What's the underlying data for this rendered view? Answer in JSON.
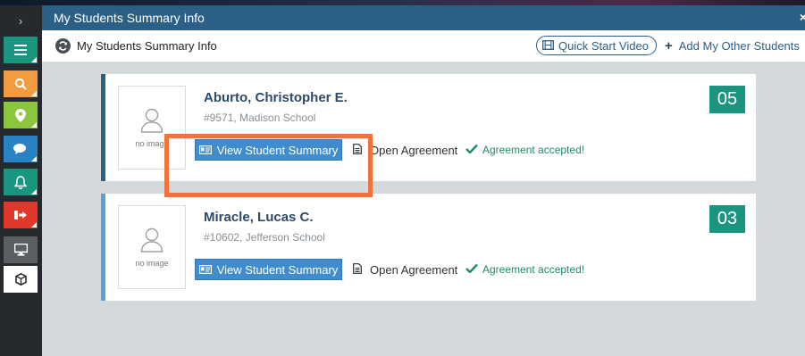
{
  "window": {
    "title": "My Students Summary Info",
    "close_label": "×"
  },
  "toolbar": {
    "title": "My Students Summary Info",
    "quick_start_label": "Quick Start Video",
    "add_students_label": "Add My Other Students"
  },
  "rail": {
    "items": [
      {
        "icon": "chevron-right-icon",
        "color": "#262a2e"
      },
      {
        "icon": "menu-icon",
        "color": "#1a9680"
      },
      {
        "icon": "search-icon",
        "color": "#f39c3f"
      },
      {
        "icon": "map-pin-icon",
        "color": "#8cc63f"
      },
      {
        "icon": "chat-icon",
        "color": "#2a82c4"
      },
      {
        "icon": "bell-icon",
        "color": "#1a9680"
      },
      {
        "icon": "sign-out-icon",
        "color": "#e0392b"
      },
      {
        "icon": "monitor-icon",
        "color": "#5a5f64"
      },
      {
        "icon": "cube-icon",
        "color": "#ffffff"
      }
    ]
  },
  "students": [
    {
      "name": "Aburto, Christopher E.",
      "details": "#9571, Madison School",
      "photo_label": "no image",
      "summary_button": "View Student Summary",
      "agreement_link": "Open Agreement",
      "agreement_status": "Agreement accepted!",
      "grade": "05"
    },
    {
      "name": "Miracle, Lucas C.",
      "details": "#10602, Jefferson School",
      "photo_label": "no image",
      "summary_button": "View Student Summary",
      "agreement_link": "Open Agreement",
      "agreement_status": "Agreement accepted!",
      "grade": "03"
    }
  ],
  "colors": {
    "header": "#2b5f86",
    "button": "#3f8dcf",
    "badge": "#1a9680",
    "accepted": "#1d8a6e",
    "highlight": "#f1733a"
  }
}
